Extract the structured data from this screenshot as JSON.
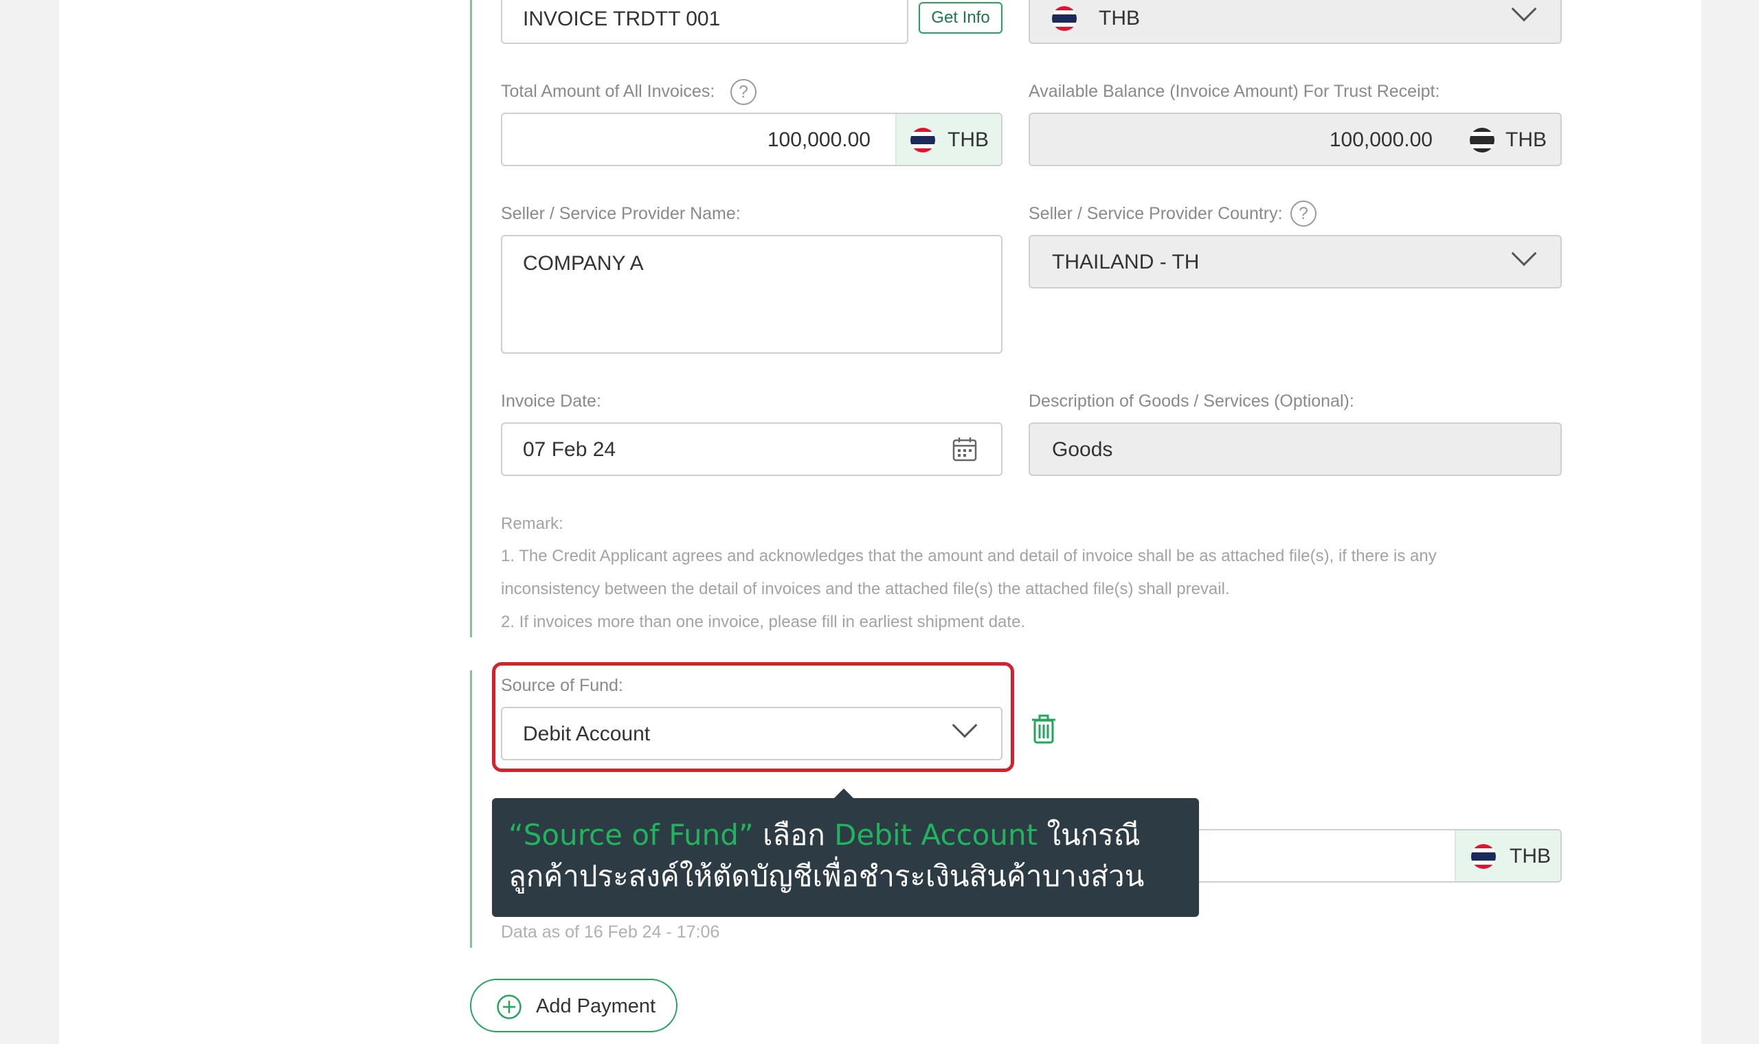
{
  "invoice": {
    "number_value": "INVOICE TRDTT 001",
    "get_info_label": "Get Info",
    "currency_value": "THB"
  },
  "total_amount": {
    "label": "Total Amount of All Invoices:",
    "value": "100,000.00",
    "currency": "THB"
  },
  "available_balance": {
    "label": "Available Balance (Invoice Amount) For Trust Receipt:",
    "value": "100,000.00",
    "currency": "THB"
  },
  "seller_name": {
    "label": "Seller / Service Provider Name:",
    "value": "COMPANY A"
  },
  "seller_country": {
    "label": "Seller / Service Provider Country:",
    "value": "THAILAND - TH"
  },
  "invoice_date": {
    "label": "Invoice Date:",
    "value": "07 Feb 24"
  },
  "description": {
    "label": "Description of Goods / Services (Optional):",
    "value": "Goods"
  },
  "remark": {
    "title": "Remark:",
    "line1": "1. The Credit Applicant agrees and acknowledges that the amount and detail of invoice shall be as attached file(s), if there is any",
    "line2": "inconsistency between the detail of invoices and the attached file(s) the attached file(s) shall prevail.",
    "line3": "2. If invoices more than one invoice, please fill in earliest shipment date."
  },
  "source_of_fund": {
    "label": "Source of Fund:",
    "value": "Debit Account"
  },
  "payment_amount": {
    "currency": "THB"
  },
  "data_as_of": "Data as of 16 Feb 24 - 17:06",
  "add_payment_label": "Add Payment",
  "tooltip": {
    "part1": "“Source of Fund”",
    "part2": " เลือก ",
    "part3": "Debit Account",
    "part4": " ในกรณี",
    "line2": "ลูกค้าประสงค์ให้ตัดบัญชีเพื่อชำระเงินสินค้าบางส่วน"
  },
  "colors": {
    "accent_green": "#1fa75a",
    "highlight_red": "#d6202a",
    "tooltip_bg": "#2d3b44"
  }
}
